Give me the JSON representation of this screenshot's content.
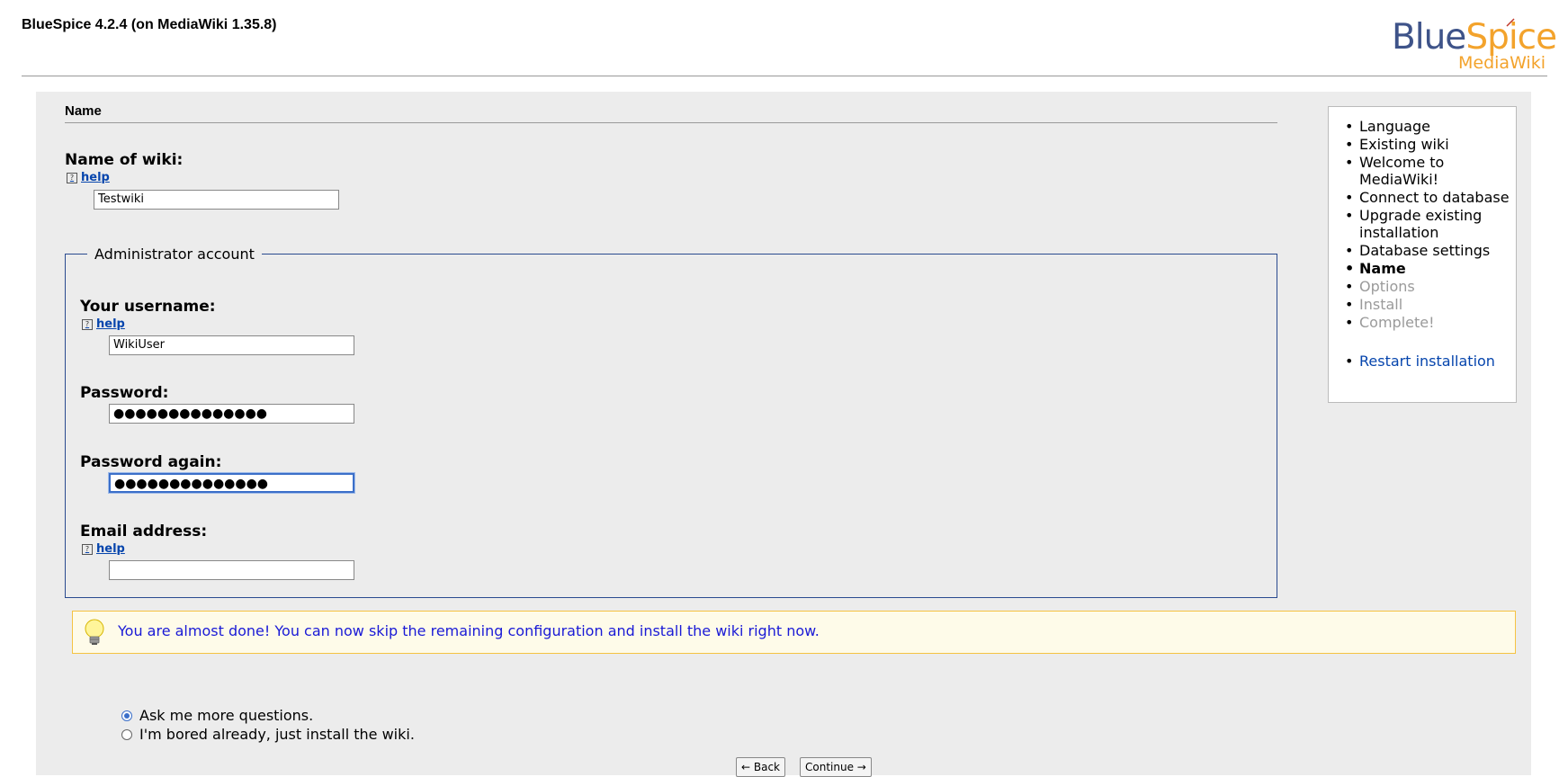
{
  "header": {
    "version": "BlueSpice 4.2.4 (on MediaWiki 1.35.8)",
    "logo_blue": "Blue",
    "logo_orange": "Spice",
    "logo_sub": "MediaWiki"
  },
  "form": {
    "section_title": "Name",
    "wiki_name_label": "Name of wiki:",
    "help_label": "help",
    "wiki_name_value": "Testwiki",
    "admin_legend": "Administrator account",
    "username_label": "Your username:",
    "username_value": "WikiUser",
    "password_label": "Password:",
    "password_value": "●●●●●●●●●●●●●●",
    "password_again_label": "Password again:",
    "password_again_value": "●●●●●●●●●●●●●●",
    "email_label": "Email address:",
    "email_value": ""
  },
  "notice": {
    "message": "You are almost done! You can now skip the remaining configuration and install the wiki right now."
  },
  "options": [
    {
      "label": "Ask me more questions.",
      "selected": true
    },
    {
      "label": "I'm bored already, just install the wiki.",
      "selected": false
    }
  ],
  "buttons": {
    "back": "← Back",
    "continue": "Continue →"
  },
  "steps": [
    {
      "label": "Language",
      "state": "done"
    },
    {
      "label": "Existing wiki",
      "state": "done"
    },
    {
      "label": "Welcome to MediaWiki!",
      "state": "done"
    },
    {
      "label": "Connect to database",
      "state": "done"
    },
    {
      "label": "Upgrade existing installation",
      "state": "done"
    },
    {
      "label": "Database settings",
      "state": "done"
    },
    {
      "label": "Name",
      "state": "current"
    },
    {
      "label": "Options",
      "state": "future"
    },
    {
      "label": "Install",
      "state": "future"
    },
    {
      "label": "Complete!",
      "state": "future"
    }
  ],
  "restart_label": "Restart installation",
  "colors": {
    "link": "#0645ad",
    "accent": "#3b6fc9",
    "notice_border": "#f5c342",
    "notice_text": "#1a1ad6"
  }
}
